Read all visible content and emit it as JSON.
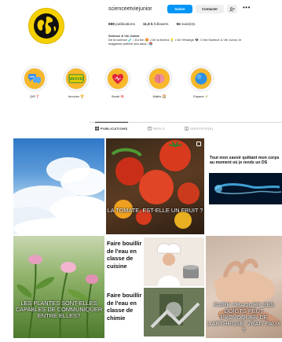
{
  "profile": {
    "username": "scienceetviejunior",
    "follow_label": "Suivre",
    "contact_label": "Contacter",
    "more_label": "•••",
    "stats": [
      {
        "count": "888",
        "label": "publications"
      },
      {
        "count": "11,9 k",
        "label": "followers"
      },
      {
        "count": "56",
        "label": "suivi(e)s"
      }
    ],
    "bio_name": "Science & Vie Junior",
    "bio_line1": "De la science 🧪 • Du fun 🤩 • De la techno 💡 • De l'étrange 👽. C'est Science & Vie Junior, le",
    "bio_line2": "magazine préféré des ados ! 📚"
  },
  "highlights": [
    {
      "label": "Q/R❓",
      "color": "#f8b82a"
    },
    {
      "label": "Innovez 🏆",
      "color": "#f8b82a"
    },
    {
      "label": "Santé 🧠",
      "color": "#f8b82a"
    },
    {
      "label": "Maths 🧮",
      "color": "#f8b82a"
    },
    {
      "label": "Espace 🪐",
      "color": "#f8b82a"
    }
  ],
  "tabs": [
    {
      "label": "PUBLICATIONS",
      "active": true
    },
    {
      "label": "REELS",
      "active": false
    },
    {
      "label": "IDENTIFIÉ(E)",
      "active": false
    }
  ],
  "posts": [
    {
      "caption": ""
    },
    {
      "caption": "LA TOMATE, EST-ELLE UN FRUIT ?"
    },
    {
      "caption": "Tout mon savoir quittant mon corps au moment où je rends un DS"
    },
    {
      "caption": "LES PLANTES SONT-ELLES CAPABLES DE COMMUNIQUER ENTRE ELLES?"
    },
    {
      "caption_top": "Faire bouillir de l'eau en classe de cuisine",
      "caption_bottom": "Faire bouillir de l'eau en classe de chimie"
    },
    {
      "caption": "FAIRE CRAQUER SES DOIGTS PEUT PROVOQUER DE L'ARTHROSE: VRAI / FAUX ?"
    }
  ],
  "colors": {
    "accent": "#0095f6",
    "highlight_ring": "#f8b82a",
    "avatar_bg": "#f5d000"
  }
}
